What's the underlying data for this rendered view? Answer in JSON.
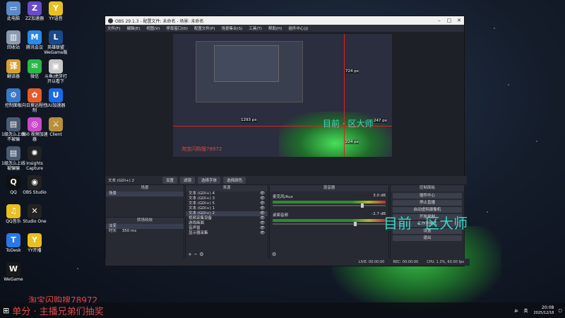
{
  "desktop": {
    "icons_col1": [
      {
        "label": "此电脑",
        "icon": "computer-icon",
        "color": "#5a8ac8",
        "glyph": "▭"
      },
      {
        "label": "回收站",
        "icon": "recycle-bin-icon",
        "color": "#8a9ab0",
        "glyph": "▥"
      },
      {
        "label": "翻译器",
        "icon": "translator-icon",
        "color": "#d8a030",
        "glyph": "译"
      },
      {
        "label": "控制面板",
        "icon": "control-panel-icon",
        "color": "#3a78c8",
        "glyph": "⚙"
      },
      {
        "label": "1级怎么上线不被骗",
        "icon": "document-icon",
        "color": "#4a5a70",
        "glyph": "▤"
      },
      {
        "label": "1级怎么上线被骗骗",
        "icon": "document-icon",
        "color": "#4a5a70",
        "glyph": "▤"
      },
      {
        "label": "QQ",
        "icon": "qq-icon",
        "color": "#111",
        "glyph": "Q"
      },
      {
        "label": "QQ音乐",
        "icon": "qq-music-icon",
        "color": "#e8c020",
        "glyph": "♫"
      },
      {
        "label": "ToDesk",
        "icon": "todesk-icon",
        "color": "#2a78e8",
        "glyph": "T"
      },
      {
        "label": "WeGame",
        "icon": "wegame-icon",
        "color": "#1a1a1a",
        "glyph": "W"
      }
    ],
    "icons_col2": [
      {
        "label": "ZZ加速器",
        "icon": "zz-accelerator-icon",
        "color": "#6a4ac8",
        "glyph": "Z"
      },
      {
        "label": "腾讯会议",
        "icon": "tencent-meeting-icon",
        "color": "#2a8ae8",
        "glyph": "M"
      },
      {
        "label": "微信",
        "icon": "wechat-icon",
        "color": "#2ab84a",
        "glyph": "✉"
      },
      {
        "label": "向日葵远程控制",
        "icon": "sunflower-icon",
        "color": "#e85a2a",
        "glyph": "✿"
      },
      {
        "label": "360 视频加速器",
        "icon": "360-icon",
        "color": "#c84ac8",
        "glyph": "◎"
      },
      {
        "label": "Insights Capture",
        "icon": "insights-capture-icon",
        "color": "#222",
        "glyph": "✺"
      },
      {
        "label": "OBS Studio",
        "icon": "obs-icon",
        "color": "#222",
        "glyph": "◉"
      },
      {
        "label": "Studio One",
        "icon": "studio-one-icon",
        "color": "#222",
        "glyph": "✕"
      },
      {
        "label": "YY开播",
        "icon": "yy-icon",
        "color": "#e8c020",
        "glyph": "Y"
      }
    ],
    "icons_col3": [
      {
        "label": "YY语音",
        "icon": "yy-voice-icon",
        "color": "#e8c020",
        "glyph": "Y"
      },
      {
        "label": "英雄联盟WeGame版",
        "icon": "lol-icon",
        "color": "#1a4a8a",
        "glyph": "L"
      },
      {
        "label": "斗鱼/虎牙打开以看下",
        "icon": "stream-icon",
        "color": "#c8c8c8",
        "glyph": "▣"
      },
      {
        "label": "UU加速器",
        "icon": "uu-icon",
        "color": "#1a6ae8",
        "glyph": "U"
      },
      {
        "label": "Client",
        "icon": "client-icon",
        "color": "#b8903a",
        "glyph": "⚔"
      }
    ]
  },
  "obs": {
    "title": "OBS 29.1.3 - 配置文件: 未命名 - 场景: 未命名",
    "menu": [
      "文件(F)",
      "编辑(E)",
      "视图(V)",
      "停靠窗口(D)",
      "配置文件(P)",
      "场景集合(S)",
      "工具(T)",
      "帮助(H)",
      "插件中心(J)"
    ],
    "preview": {
      "px_top": "724 px",
      "px_left": "1293 px",
      "px_right": "247 px",
      "px_bottom": "224 px",
      "source_label": "淘宝闪购搜78972",
      "overlay_text": "目前 · 区大师"
    },
    "toolbar": {
      "source_name": "文本 (GDI+) 2",
      "settings": "设置",
      "filters": "滤镜",
      "font": "选择字体",
      "color": "选择颜色"
    },
    "scenes": {
      "header": "场景",
      "items": [
        "场景"
      ]
    },
    "sources": {
      "header": "来源",
      "items": [
        "文本 (GDI+) 4",
        "文本 (GDI+) 3",
        "文本 (GDI+) 5",
        "文本 (GDI+) 1",
        "文本 (GDI+) 2",
        "视频采集设备",
        "游戏画面",
        "音声窗",
        "显示器采集"
      ]
    },
    "transition": {
      "header": "转场特效",
      "type": "淡变",
      "duration_label": "时长",
      "duration": "350 ms"
    },
    "mixer": {
      "header": "混音器",
      "channels": [
        {
          "name": "麦克风/Aux",
          "db": "3.0 dB",
          "level": 0.78
        },
        {
          "name": "桌面音频",
          "db": "-2.7 dB",
          "level": 0.72
        }
      ]
    },
    "controls": {
      "header": "控制面板",
      "items": [
        "插件中心",
        "停止直播",
        "启动虚拟摄像机",
        "开始录制",
        "工作室模式",
        "设置",
        "退出"
      ]
    },
    "status": {
      "live": "LIVE: 00:00:00",
      "rec": "REC: 00:00:00",
      "cpu": "CPU: 1.3%, 60.00 fps"
    }
  },
  "overlays": {
    "big_text": "目前 · 区大师",
    "bottom_text": "淘宝闪购搜78972",
    "bottom_line": "单分 · 主播兄弟们抽奖"
  },
  "taskbar": {
    "lang": "英",
    "time": "20:08",
    "date": "2025/12/18"
  }
}
